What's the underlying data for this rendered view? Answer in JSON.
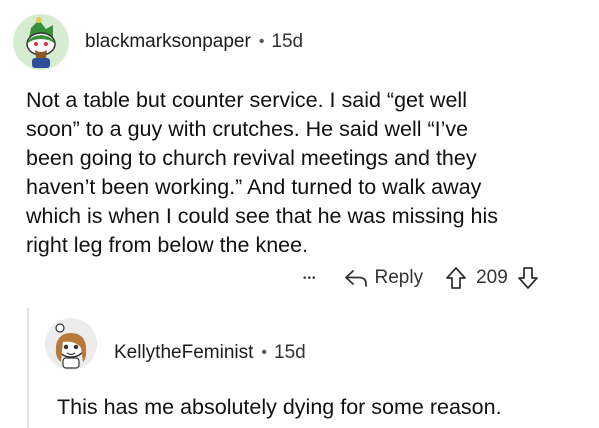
{
  "comment": {
    "username": "blackmarksonpaper",
    "age": "15d",
    "body_lines": [
      "Not a table but counter service. I said “get well",
      "soon” to a guy with crutches. He said well “I’ve",
      "been going to church revival meetings and they",
      "haven’t been working.” And turned to walk away",
      "which is when I could see that he was missing his",
      "right leg from below the knee."
    ],
    "more_label": "•••",
    "reply_label": "Reply",
    "score": "209"
  },
  "reply": {
    "username": "KellytheFeminist",
    "age": "15d",
    "body": "This has me absolutely dying for some reason."
  },
  "separator": "•",
  "icons": {
    "upvote": "upvote-arrow-icon",
    "downvote": "downvote-arrow-icon",
    "reply": "reply-arrow-icon",
    "more": "more-options-icon"
  },
  "colors": {
    "text": "#1c1c1c",
    "muted": "#555555",
    "avatar1_bg": "#d6ecd0",
    "avatar2_bg": "#ececec"
  }
}
